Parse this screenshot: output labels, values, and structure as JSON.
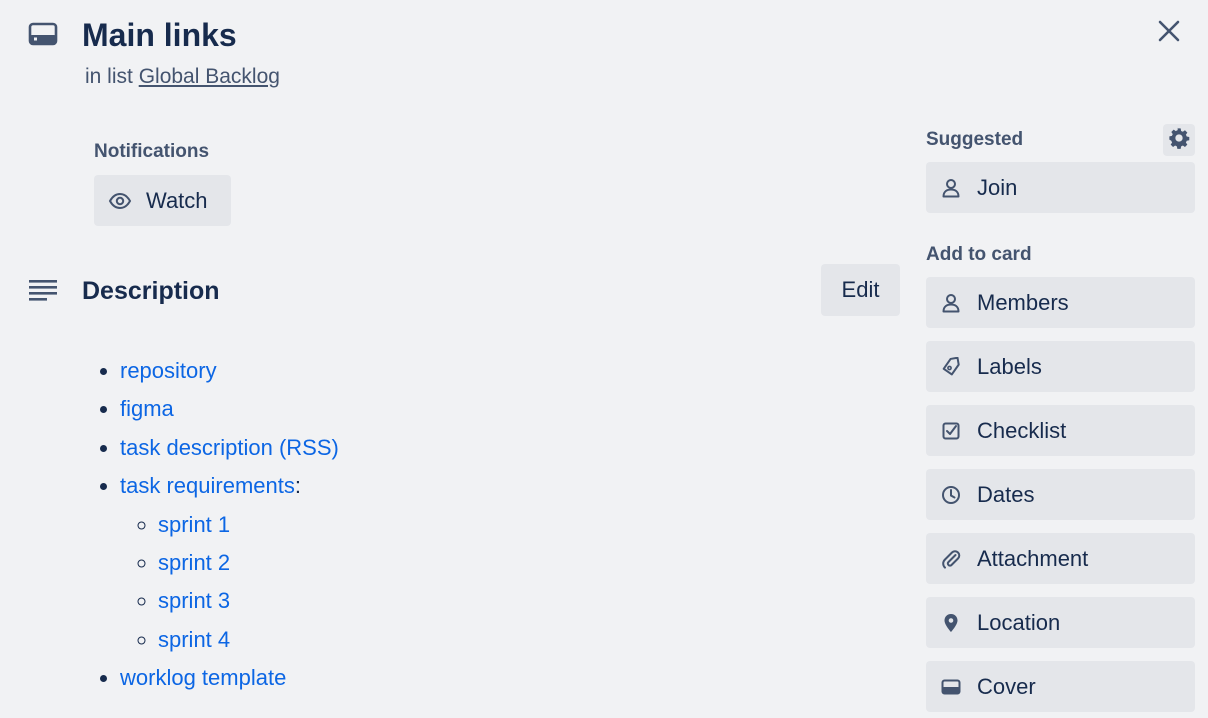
{
  "header": {
    "title": "Main links",
    "in_list_prefix": "in list",
    "list_name": "Global Backlog"
  },
  "notifications": {
    "label": "Notifications",
    "watch_label": "Watch"
  },
  "description": {
    "title": "Description",
    "edit_label": "Edit",
    "items": [
      {
        "text": "repository"
      },
      {
        "text": "figma"
      },
      {
        "text": "task description (RSS)"
      },
      {
        "text": "task requirements",
        "suffix": ":",
        "children": [
          "sprint 1",
          "sprint 2",
          "sprint 3",
          "sprint 4"
        ]
      },
      {
        "text": "worklog template"
      }
    ]
  },
  "sidebar": {
    "suggested_label": "Suggested",
    "join_label": "Join",
    "add_to_card_label": "Add to card",
    "buttons": [
      {
        "label": "Members",
        "icon": "person-icon"
      },
      {
        "label": "Labels",
        "icon": "tag-icon"
      },
      {
        "label": "Checklist",
        "icon": "checklist-icon"
      },
      {
        "label": "Dates",
        "icon": "clock-icon"
      },
      {
        "label": "Attachment",
        "icon": "paperclip-icon"
      },
      {
        "label": "Location",
        "icon": "location-pin-icon"
      },
      {
        "label": "Cover",
        "icon": "cover-icon"
      }
    ]
  },
  "colors": {
    "background": "#f1f2f4",
    "button": "#e4e6ea",
    "link": "#0c66e4",
    "text": "#172b4d",
    "subtle_text": "#44546f"
  }
}
